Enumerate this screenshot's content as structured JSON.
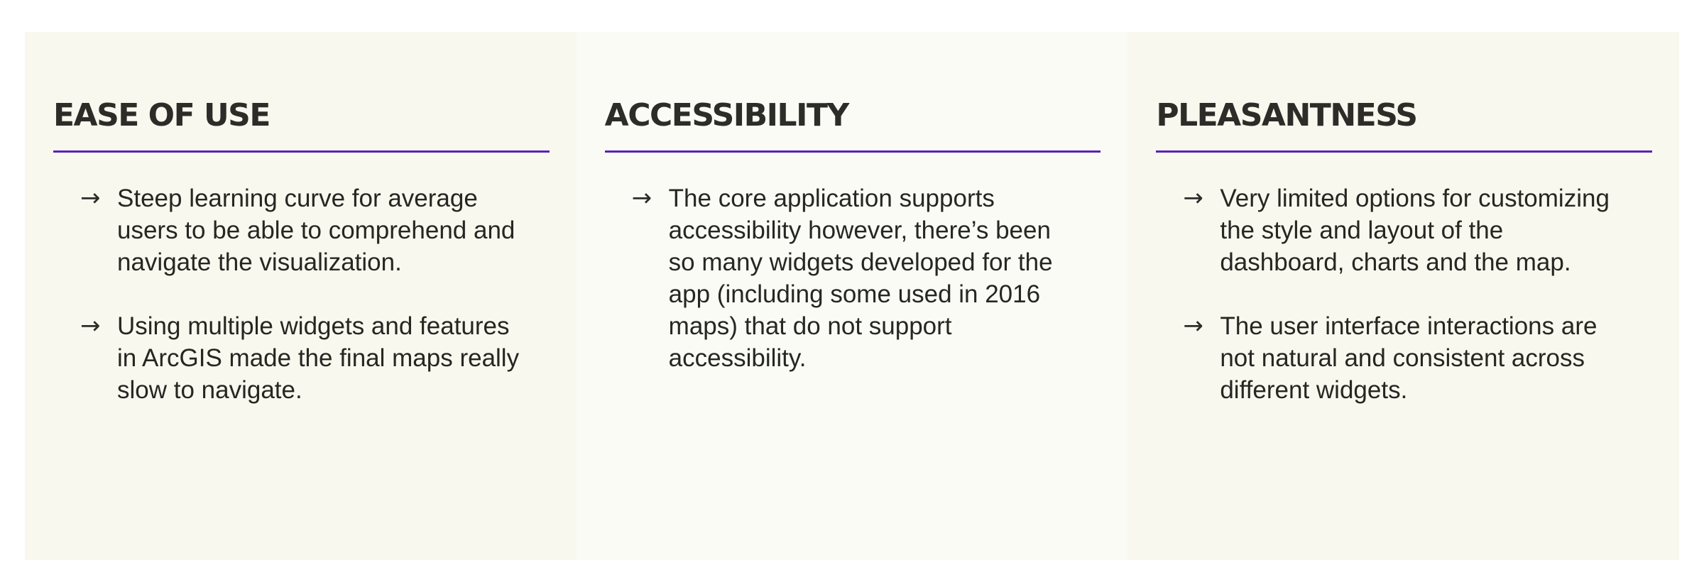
{
  "columns": [
    {
      "title": "EASE OF USE",
      "points": [
        "Steep learning curve for average users to be able to comprehend and navigate the visualization.",
        "Using multiple widgets and features in ArcGIS made the final maps really slow to navigate."
      ]
    },
    {
      "title": "ACCESSIBILITY",
      "points": [
        "The core application supports accessibility however, there’s been so many widgets developed for the app (including some used in 2016 maps)  that do not support accessibility."
      ]
    },
    {
      "title": "PLEASANTNESS",
      "points": [
        "Very limited options for customizing the style and layout of the dashboard, charts and the map.",
        "The user interface interactions are not natural and consistent across different widgets."
      ]
    }
  ],
  "icons": {
    "bullet": "→",
    "bullet_name": "arrow-right-icon"
  },
  "colors": {
    "divider": "#5a22b8",
    "panel_background": "#f8f8ee",
    "panel_background_alt": "#fbfbf6",
    "text": "#262622"
  }
}
